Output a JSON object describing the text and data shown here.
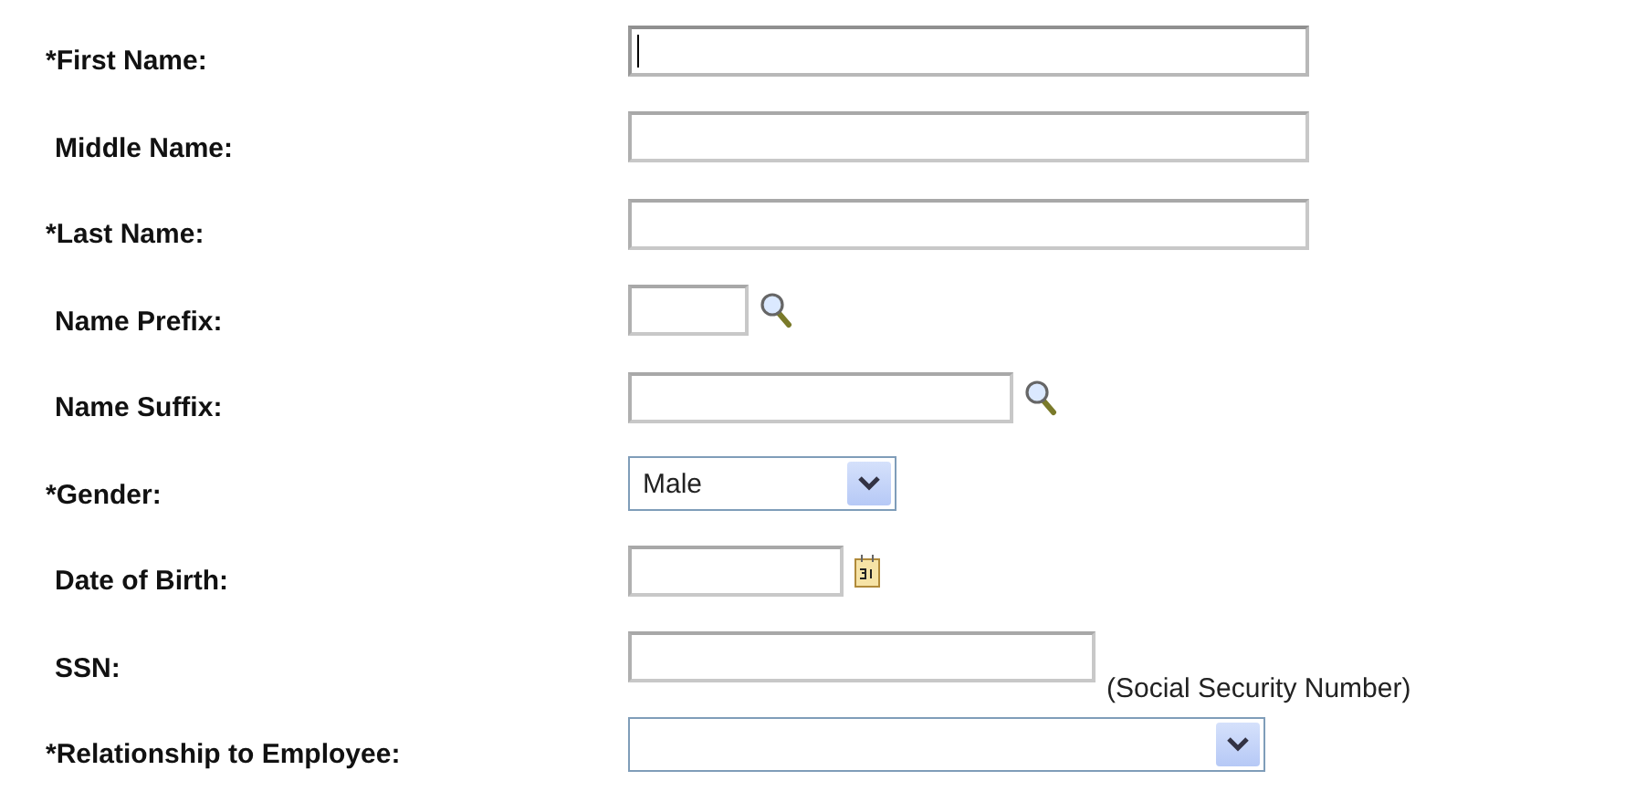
{
  "fields": [
    {
      "label": "*First Name:",
      "required": true,
      "kind": "text",
      "focused": true
    },
    {
      "label": "Middle Name:",
      "required": false,
      "kind": "text",
      "focused": false
    },
    {
      "label": "*Last Name:",
      "required": true,
      "kind": "text",
      "focused": false
    },
    {
      "label": "Name Prefix:",
      "required": false,
      "kind": "text",
      "addon": {
        "kind": "lookup"
      },
      "focused": false
    },
    {
      "label": "Name Suffix:",
      "required": false,
      "kind": "text",
      "addon": {
        "kind": "lookup"
      },
      "focused": false
    },
    {
      "label": "*Gender:",
      "required": true,
      "kind": "select",
      "value": "Male"
    },
    {
      "label": "Date of Birth:",
      "required": false,
      "kind": "text",
      "addon": {
        "kind": "calendar"
      },
      "focused": false
    },
    {
      "label": "SSN:",
      "required": false,
      "kind": "text",
      "note": "(Social Security Number)",
      "focused": false
    },
    {
      "label": "*Relationship to Employee:",
      "required": true,
      "kind": "select"
    }
  ]
}
